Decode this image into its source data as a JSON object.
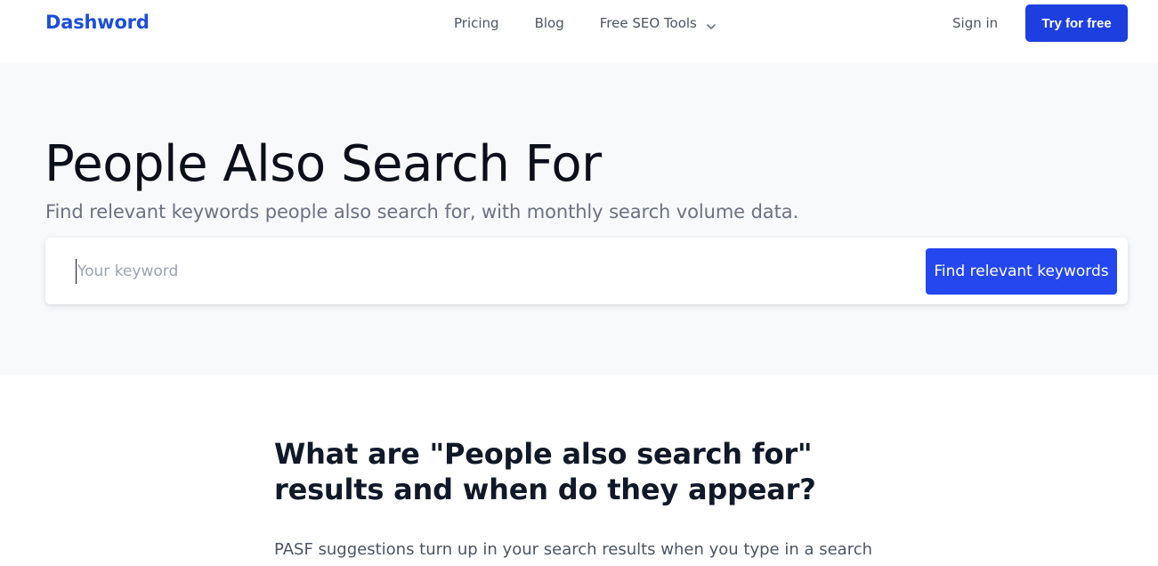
{
  "header": {
    "logo": "Dashword",
    "nav": {
      "pricing": "Pricing",
      "blog": "Blog",
      "free_seo_tools": "Free SEO Tools"
    },
    "signin": "Sign in",
    "cta": "Try for free"
  },
  "hero": {
    "title": "People Also Search For",
    "subtitle": "Find relevant keywords people also search for, with monthly search volume data.",
    "search": {
      "placeholder": "Your keyword",
      "value": "",
      "button_label": "Find relevant keywords"
    }
  },
  "content": {
    "heading": "What are \"People also search for\" results and when do they appear?",
    "paragraph": "PASF suggestions turn up in your search results when you type in a search"
  },
  "colors": {
    "brand": "#1d4ed8",
    "primary_button": "#1d3fe0",
    "hero_background": "#f8f9fb"
  },
  "icons": {
    "dropdown": "chevron-down-icon"
  }
}
